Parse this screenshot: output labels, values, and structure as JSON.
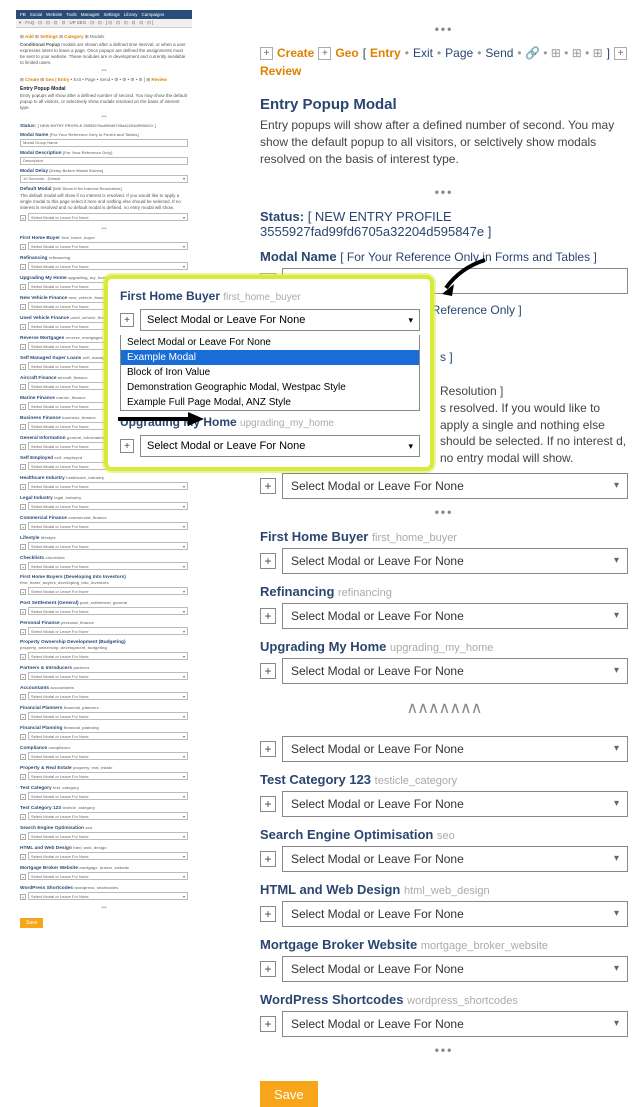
{
  "topbar_tabs": [
    "FB",
    "Social",
    "Website",
    "Tools",
    "ManageIt",
    "Settings",
    "Library",
    "Campaigns"
  ],
  "crumb_left": {
    "add": "Add",
    "settings": "Settings",
    "category": "Category",
    "modals": "Modals"
  },
  "thumb": {
    "cond_heading": "Conditional Popup",
    "cond_text": "modals are shown after a defined time interval, or when a user expresses intent to leave a page. Once popups are defined the assignments must be sent to your website. These modules are in development and currently available to limited users.",
    "sub_crumb": "Create  •  Geo  •  [ Entry • Exit • Page • Send • ⚙ • ⚙ • ⚙ • ⚙ ]  •  Review",
    "entry_heading": "Entry Popup Modal",
    "entry_text": "Entry popups will show after a defined number of second. You may show the default popup to all visitors, or selectively show modals resolved on the basis of interest type.",
    "status_label": "Status:",
    "status_value": "[ NEW ENTRY PROFILE 3555927fad99fd6705a32204d595847e ]",
    "modal_name_label": "Modal Name",
    "modal_name_hint": "[For Your Reference Only in Forms and Tables]",
    "modal_name_placeholder": "Modal Group Name",
    "modal_desc_label": "Modal Description",
    "modal_desc_hint": "[For Your Reference Only]",
    "modal_desc_placeholder": "Description",
    "modal_delay_label": "Modal Delay",
    "modal_delay_hint": "[Delay Before Modal Shows]",
    "modal_delay_value": "10 Seconds - Default",
    "default_modal_label": "Default Modal",
    "default_modal_hint": "[Will Show if No Interest Resolution]",
    "default_modal_text": "The default modal will show if no interest is resolved. If you would like to apply a single modal to this page select it here and nothing else should be selected. If no interest is resolved and no default modal is defined, no entry modal will show.",
    "select_placeholder": "Select Modal or Leave For None",
    "categories_small": [
      {
        "label": "First Home Buyer",
        "slug": "first_home_buyer"
      },
      {
        "label": "Refinancing",
        "slug": "refinancing"
      },
      {
        "label": "Upgrading My Home",
        "slug": "upgrading_my_home"
      },
      {
        "label": "New Vehicle Finance",
        "slug": "new_vehicle_finance"
      },
      {
        "label": "Used Vehicle Finance",
        "slug": "used_vehicle_finance"
      },
      {
        "label": "Reverse Mortgages",
        "slug": "reverse_mortgages"
      },
      {
        "label": "Self Managed Super Loans",
        "slug": "self_managed_super_loans"
      },
      {
        "label": "Aircraft Finance",
        "slug": "aircraft_finance"
      },
      {
        "label": "Marine Finance",
        "slug": "marine_finance"
      },
      {
        "label": "Business Finance",
        "slug": "business_finance"
      },
      {
        "label": "General Information",
        "slug": "general_information"
      },
      {
        "label": "Self Employed",
        "slug": "self_employed"
      },
      {
        "label": "Healthcare Industry",
        "slug": "healthcare_industry"
      },
      {
        "label": "Legal Industry",
        "slug": "legal_industry"
      },
      {
        "label": "Commercial Finance",
        "slug": "commercial_finance"
      },
      {
        "label": "Lifestyle",
        "slug": "lifestyle"
      },
      {
        "label": "Checklists",
        "slug": "checklists"
      },
      {
        "label": "First Home Buyers (Developing Into Investors)",
        "slug": "first_home_buyers_developing_into_investors"
      },
      {
        "label": "Post Settlement (General)",
        "slug": "post_settlement_general"
      },
      {
        "label": "Personal Finance",
        "slug": "personal_finance"
      },
      {
        "label": "Property Ownership Development (Budgeting)",
        "slug": "property_ownership_development_budgeting"
      },
      {
        "label": "Partners & Introducers",
        "slug": "partners"
      },
      {
        "label": "Accountants",
        "slug": "accountants"
      },
      {
        "label": "Financial Planners",
        "slug": "financial_planners"
      },
      {
        "label": "Financial Planning",
        "slug": "financial_planning"
      },
      {
        "label": "Compliance",
        "slug": "compliance"
      },
      {
        "label": "Property & Real Estate",
        "slug": "property_real_estate"
      },
      {
        "label": "Test Category",
        "slug": "test_category"
      },
      {
        "label": "Test Category 123",
        "slug": "testicle_category"
      },
      {
        "label": "Search Engine Optimisation",
        "slug": "seo"
      },
      {
        "label": "HTML and Web Design",
        "slug": "html_web_design"
      },
      {
        "label": "Mortgage Broker Website",
        "slug": "mortgage_broker_website"
      },
      {
        "label": "WordPress Shortcodes",
        "slug": "wordpress_shortcodes"
      }
    ],
    "save": "Save"
  },
  "main": {
    "create": "Create",
    "geo": "Geo",
    "entry": "Entry",
    "exit": "Exit",
    "page": "Page",
    "send": "Send",
    "review": "Review",
    "h2": "Entry Popup Modal",
    "para": "Entry popups will show after a defined number of second. You may show the default popup to all visitors, or selctively show modals resolved on the basis of interest type.",
    "status_label": "Status:",
    "status_value": "[ NEW ENTRY PROFILE 3555927fad99fd6705a32204d595847e ]",
    "modal_name_label": "Modal Name",
    "modal_name_hint": "[ For Your Reference Only in Forms and Tables ]",
    "modal_name_placeholder": "Modal Group Name",
    "modal_desc_label": "Modal Description",
    "modal_desc_hint": "[ For Your Reference Only ]",
    "frag_resolution": "Resolution ]",
    "frag_text": "s resolved. If you would like to apply a single and nothing else should be selected. If no interest d, no entry modal will show.",
    "select_placeholder": "Select Modal or Leave For None",
    "categories": [
      {
        "label": "First Home Buyer",
        "slug": "first_home_buyer"
      },
      {
        "label": "Refinancing",
        "slug": "refinancing"
      },
      {
        "label": "Upgrading My Home",
        "slug": "upgrading_my_home"
      }
    ],
    "categories_lower": [
      {
        "label": "",
        "slug": ""
      },
      {
        "label": "Test Category 123",
        "slug": "testicle_category"
      },
      {
        "label": "Search Engine Optimisation",
        "slug": "seo"
      },
      {
        "label": "HTML and Web Design",
        "slug": "html_web_design"
      },
      {
        "label": "Mortgage Broker Website",
        "slug": "mortgage_broker_website"
      },
      {
        "label": "WordPress Shortcodes",
        "slug": "wordpress_shortcodes"
      }
    ],
    "save": "Save"
  },
  "popup": {
    "cat1_label": "First Home Buyer",
    "cat1_slug": "first_home_buyer",
    "select_placeholder": "Select Modal or Leave For None",
    "options": [
      "Select Modal or Leave For None",
      "Example Modal",
      "Block of Iron Value",
      "Demonstration Geographic Modal, Westpac Style",
      "Example Full Page Modal, ANZ Style"
    ],
    "cat2_label": "Upgrading My Home",
    "cat2_slug": "upgrading_my_home",
    "select2": "Select Modal or Leave For None"
  }
}
